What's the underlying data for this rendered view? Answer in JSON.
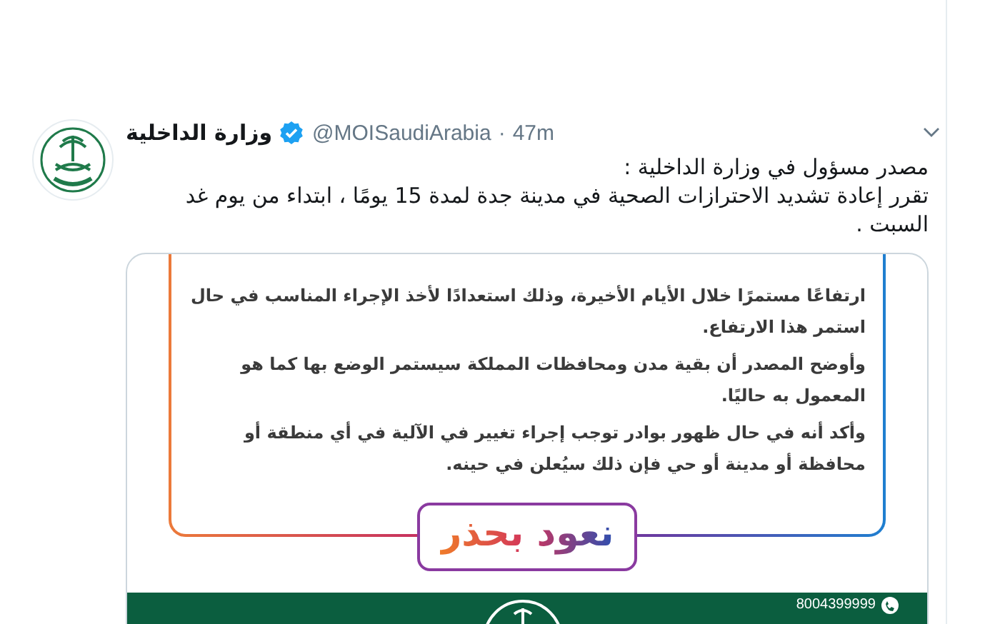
{
  "tweet": {
    "name": "وزارة الداخلية",
    "verified": true,
    "handle": "@MOISaudiArabia",
    "separator": "·",
    "time": "47m",
    "text": "مصدر مسؤول في وزارة الداخلية :\nتقرر إعادة تشديد الاحترازات الصحية في مدينة جدة لمدة 15 يومًا ، ابتداء من يوم غد السبت .",
    "attachment": {
      "paragraphs": [
        "ارتفاعًا مستمرًا خلال الأيام الأخيرة، وذلك استعدادًا لأخذ الإجراء المناسب في حال استمر هذا الارتفاع.",
        "وأوضح المصدر أن بقية مدن ومحافظات المملكة سيستمر الوضع بها كما هو المعمول به حاليًا.",
        "وأكد أنه في حال ظهور بوادر توجب إجراء تغيير في الآلية في أي منطقة أو محافظة أو مدينة أو حي فإن ذلك سيُعلن في حينه."
      ],
      "slogan": "نعود بحذر",
      "phone": "8004399999"
    }
  }
}
